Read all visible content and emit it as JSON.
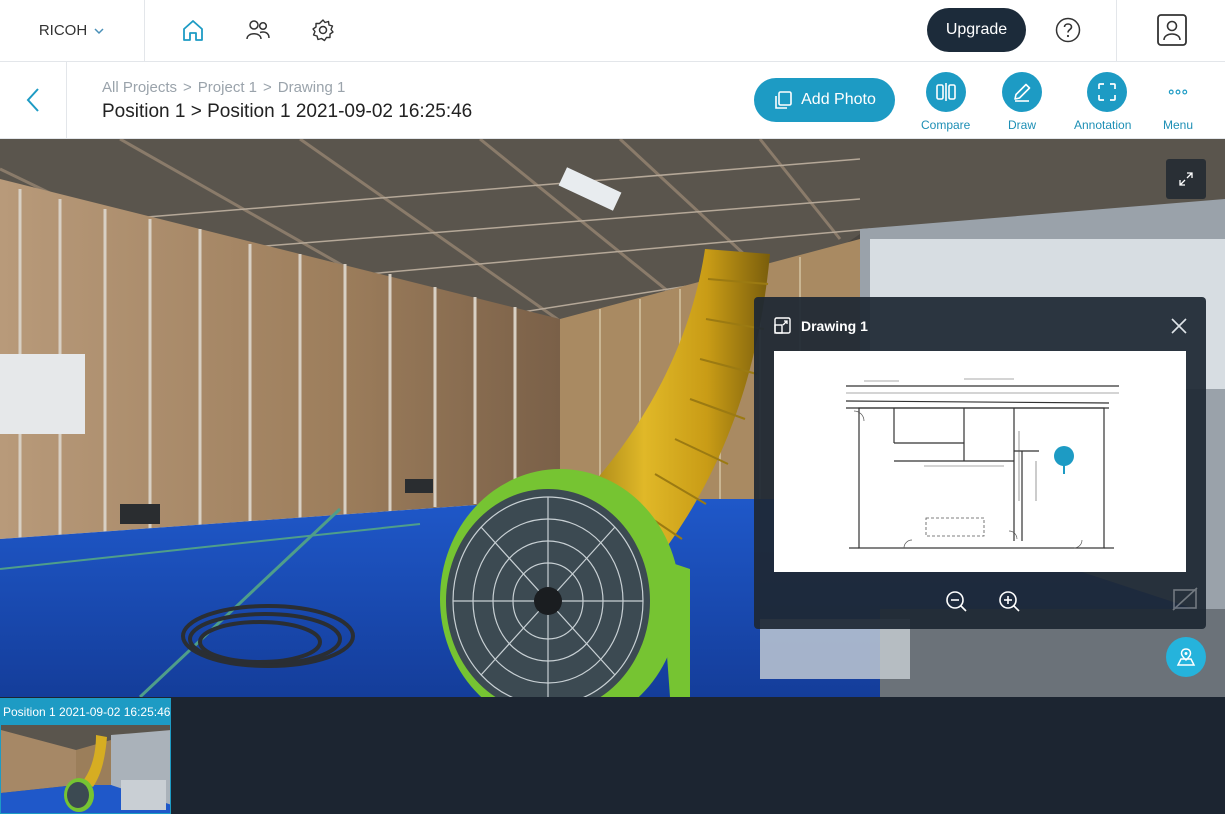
{
  "topbar": {
    "brand": "RICOH",
    "upgrade_label": "Upgrade",
    "icons": [
      "home-icon",
      "team-icon",
      "settings-icon",
      "help-icon",
      "account-icon"
    ],
    "accent_color": "#1d9bc4"
  },
  "breadcrumb": {
    "items": [
      "All Projects",
      "Project 1",
      "Drawing 1"
    ],
    "separator": ">"
  },
  "page_title": "Position 1 > Position 1 2021-09-02 16:25:46",
  "toolbar": {
    "add_photo_label": "Add Photo",
    "compare_label": "Compare",
    "draw_label": "Draw",
    "annotation_label": "Annotation",
    "menu_label": "Menu"
  },
  "drawing_panel": {
    "title": "Drawing 1"
  },
  "filmstrip": {
    "items": [
      {
        "label": "Position 1 2021-09-02 16:25:46",
        "selected": true
      }
    ]
  }
}
